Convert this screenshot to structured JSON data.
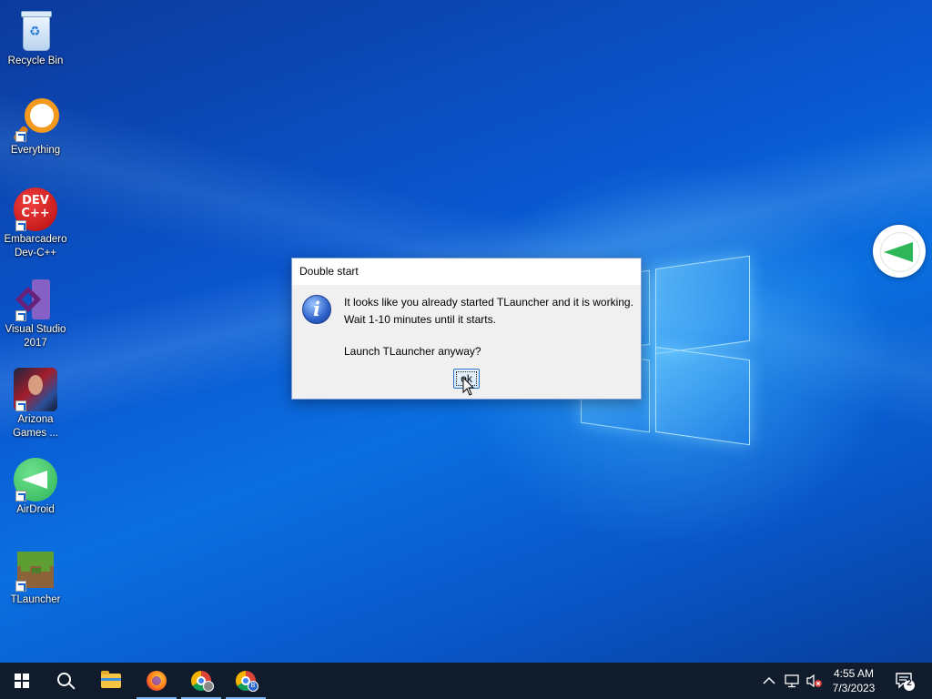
{
  "desktop_icons": [
    {
      "label": "Recycle Bin",
      "icon": "recycle-bin-icon"
    },
    {
      "label": "Everything",
      "icon": "everything-icon"
    },
    {
      "label": "Embarcadero Dev-C++",
      "icon": "dev-cpp-icon",
      "text": "DEV C++"
    },
    {
      "label": "Visual Studio 2017",
      "icon": "visual-studio-icon"
    },
    {
      "label": "Arizona Games ...",
      "icon": "arizona-games-icon"
    },
    {
      "label": "AirDroid",
      "icon": "airdroid-icon"
    },
    {
      "label": "TLauncher",
      "icon": "tlauncher-icon"
    }
  ],
  "dialog": {
    "title": "Double start",
    "icon": "info-icon",
    "icon_glyph": "i",
    "line1": "It looks like you already started TLauncher and it is working.",
    "line2": "Wait 1-10 minutes until it starts.",
    "line3": "Launch TLauncher anyway?",
    "ok_label": "ok"
  },
  "taskbar": {
    "items": [
      {
        "name": "start-button",
        "icon": "windows-logo-icon"
      },
      {
        "name": "search-button",
        "icon": "search-icon"
      },
      {
        "name": "file-explorer-button",
        "icon": "folder-icon"
      },
      {
        "name": "firefox-button",
        "icon": "firefox-icon"
      },
      {
        "name": "chrome-button",
        "icon": "chrome-icon"
      },
      {
        "name": "chrome-profile-b-button",
        "icon": "chrome-icon",
        "badge": "B"
      }
    ],
    "clock_time": "4:55 AM",
    "clock_date": "7/3/2023",
    "notification_count": "2"
  },
  "colors": {
    "taskbar": "#101b2b",
    "dialog_bg": "#f0f0f0",
    "accent": "#2b72c8"
  }
}
